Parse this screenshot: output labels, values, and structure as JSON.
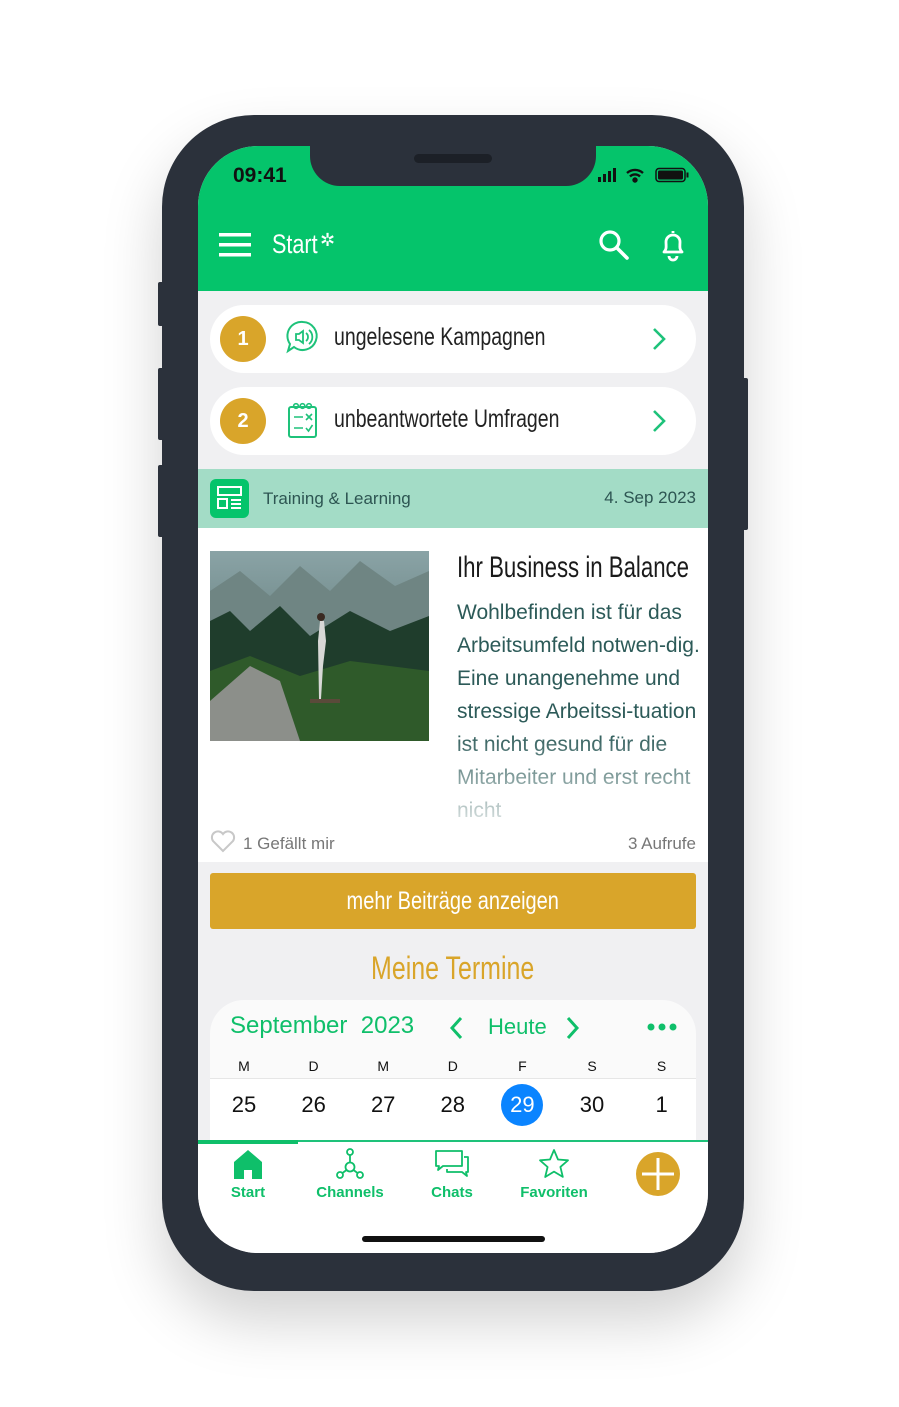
{
  "status": {
    "time": "09:41"
  },
  "header": {
    "title": "Start",
    "settings_icon": "gear-icon",
    "search_icon": "search-icon",
    "bell_icon": "bell-icon",
    "menu_icon": "hamburger-icon"
  },
  "summary": [
    {
      "count": "1",
      "label": "ungelesene Kampagnen",
      "icon": "speech-speaker-icon"
    },
    {
      "count": "2",
      "label": "unbeantwortete Umfragen",
      "icon": "survey-clipboard-icon"
    }
  ],
  "post": {
    "channel": "Training & Learning",
    "date": "4. Sep 2023",
    "title": "Ihr Business in Balance",
    "text": "Wohlbefinden ist für das Arbeitsumfeld notwen-dig. Eine unangenehme und stressige Arbeitssi-tuation ist nicht gesund für die Mitarbeiter und erst recht nicht",
    "likes": "1 Gefällt mir",
    "views": "3 Aufrufe"
  },
  "more_button": "mehr Beiträge anzeigen",
  "appointments": {
    "title": "Meine Termine",
    "month": "September",
    "year": "2023",
    "today": "Heute",
    "weekdays": [
      "M",
      "D",
      "M",
      "D",
      "F",
      "S",
      "S"
    ],
    "days": [
      "25",
      "26",
      "27",
      "28",
      "29",
      "30",
      "1"
    ],
    "selected": "29"
  },
  "tabs": [
    {
      "label": "Start",
      "icon": "home-icon",
      "active": true
    },
    {
      "label": "Channels",
      "icon": "network-icon"
    },
    {
      "label": "Chats",
      "icon": "chat-bubbles-icon"
    },
    {
      "label": "Favoriten",
      "icon": "star-icon"
    }
  ],
  "colors": {
    "primary": "#05c46b",
    "accent": "#d9a52a",
    "selected_day": "#0a84ff",
    "band": "#a3dcc6"
  }
}
